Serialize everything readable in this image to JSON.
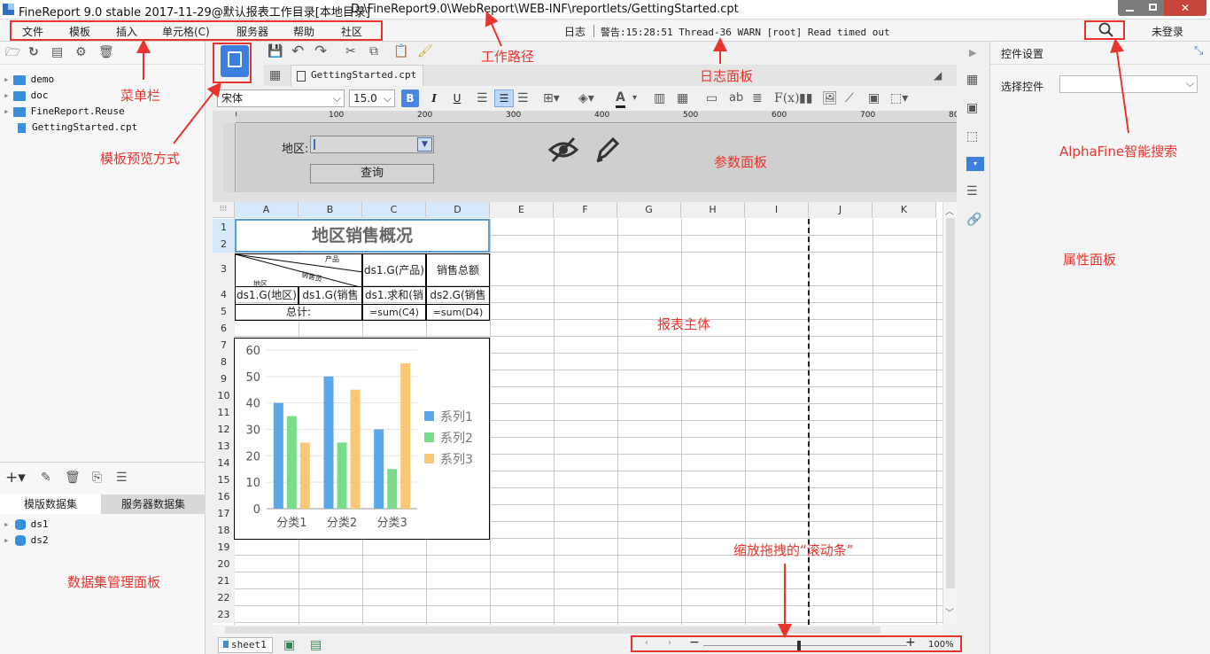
{
  "title_bar": {
    "title": "FineReport 9.0 stable 2017-11-29@默认报表工作目录[本地目录]",
    "path": "D:\\FineReport9.0\\WebReport\\WEB-INF\\reportlets/GettingStarted.cpt"
  },
  "menu": {
    "items": [
      "文件",
      "模板",
      "插入",
      "单元格(C)",
      "服务器",
      "帮助",
      "社区"
    ],
    "log": "日志",
    "warning": "警告:15:28:51 Thread-36 WARN [root] Read timed out",
    "login": "未登录"
  },
  "tree": {
    "items": [
      "demo",
      "doc",
      "FineReport.Reuse",
      "GettingStarted.cpt"
    ]
  },
  "datasets": {
    "tabs": [
      "模版数据集",
      "服务器数据集"
    ],
    "items": [
      "ds1",
      "ds2"
    ]
  },
  "editor": {
    "tab": "GettingStarted.cpt",
    "font": "宋体",
    "font_size": "15.0",
    "ruler": [
      "0",
      "100",
      "200",
      "300",
      "400",
      "500",
      "600",
      "700",
      "800"
    ]
  },
  "param_panel": {
    "region_label": "地区:",
    "query_button": "查询"
  },
  "grid": {
    "columns": [
      "A",
      "B",
      "C",
      "D",
      "E",
      "F",
      "G",
      "H",
      "I",
      "J",
      "K"
    ],
    "rows": [
      "1",
      "2",
      "3",
      "4",
      "5",
      "6",
      "7",
      "8",
      "9",
      "10",
      "11",
      "12",
      "13",
      "14",
      "15",
      "16",
      "17",
      "18",
      "19",
      "20",
      "21",
      "22",
      "23"
    ],
    "title": "地区销售概况",
    "header_product": "产品",
    "header_sales": "销售员",
    "header_region": "地区",
    "c3": "ds1.G(产品)",
    "d3": "销售总额",
    "a4": "ds1.G(地区)",
    "b4": "ds1.G(销售",
    "c4": "ds1.求和(销",
    "d4": "ds2.G(销售",
    "a5": "总计:",
    "c5": "=sum(C4)",
    "d5": "=sum(D4)"
  },
  "chart_data": {
    "type": "bar",
    "categories": [
      "分类1",
      "分类2",
      "分类3"
    ],
    "series": [
      {
        "name": "系列1",
        "values": [
          40,
          50,
          30
        ],
        "color": "#5aa7ea"
      },
      {
        "name": "系列2",
        "values": [
          35,
          25,
          15
        ],
        "color": "#78dc88"
      },
      {
        "name": "系列3",
        "values": [
          25,
          45,
          55
        ],
        "color": "#f8c876"
      }
    ],
    "yticks": [
      "0",
      "10",
      "20",
      "30",
      "40",
      "50",
      "60"
    ],
    "ylim": [
      0,
      60
    ],
    "legend": "right",
    "grid": true
  },
  "sheet": {
    "tab": "sheet1",
    "zoom": "100%"
  },
  "right_panel": {
    "title": "控件设置",
    "select_label": "选择控件",
    "select_value": ""
  },
  "annotations": {
    "menu_bar": "菜单栏",
    "work_path": "工作路径",
    "log_panel": "日志面板",
    "preview_mode": "模板预览方式",
    "param_panel": "参数面板",
    "alphafine": "AlphaFine智能搜索",
    "property_panel": "属性面板",
    "report_body": "报表主体",
    "dataset_panel": "数据集管理面板",
    "zoom_scroll": "缩放拖拽的“滚动条”"
  },
  "colors": {
    "accent": "#3d7fdc",
    "annotation": "#e8342c",
    "selection": "#3a8fdc"
  }
}
